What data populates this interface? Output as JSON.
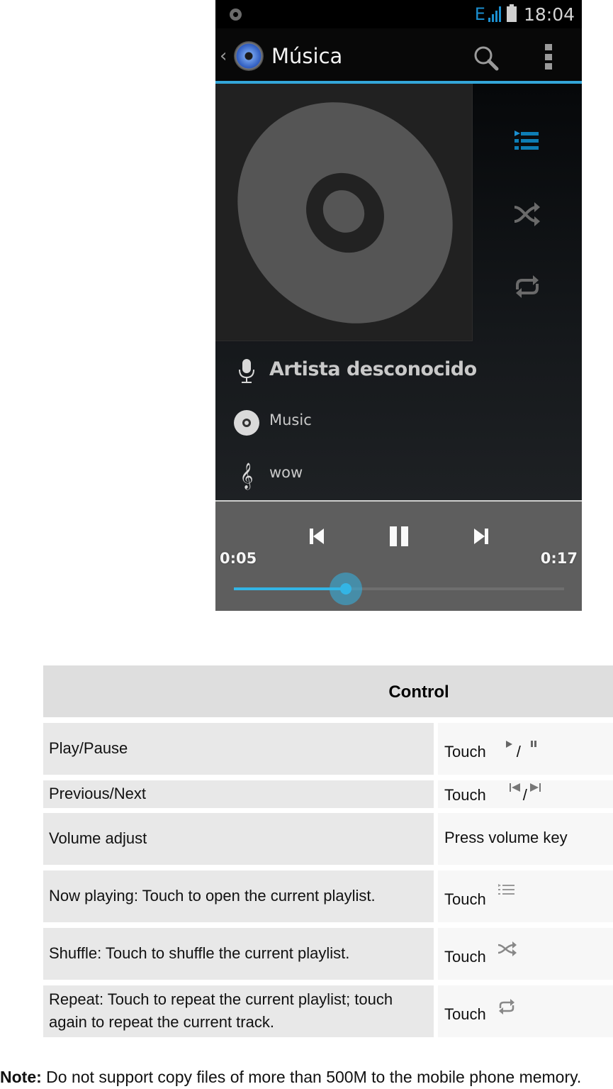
{
  "phone": {
    "status_bar": {
      "notification_icon": "circle-notification-icon",
      "network_type": "E",
      "signal_icon": "signal-bars-icon",
      "battery_icon": "battery-icon",
      "time": "18:04"
    },
    "action_bar": {
      "back_icon": "chevron-left-icon",
      "app_icon": "speaker-icon",
      "title": "Música",
      "search_icon": "search-icon",
      "overflow_icon": "overflow-menu-icon",
      "accent_color": "#33a6d9"
    },
    "artwork": {
      "icon": "album-disc-icon"
    },
    "side_controls": [
      {
        "name": "now-playing",
        "icon": "playlist-icon",
        "active": true,
        "color": "#1b8fd0"
      },
      {
        "name": "shuffle",
        "icon": "shuffle-icon",
        "active": false,
        "color": "#666666"
      },
      {
        "name": "repeat",
        "icon": "repeat-icon",
        "active": false,
        "color": "#666666"
      }
    ],
    "track_info": {
      "artist": "Artista desconocido",
      "album": "Music",
      "title": "wow"
    },
    "playback": {
      "elapsed": "0:05",
      "duration": "0:17",
      "progress_fraction": 0.34,
      "state": "playing",
      "accent_color": "#33b5e5",
      "buttons": [
        "previous",
        "pause",
        "next"
      ]
    }
  },
  "table": {
    "header": "Control",
    "rows": [
      {
        "action": "Play/Pause",
        "method": "Touch",
        "icons": [
          "play-icon",
          "pause-icon"
        ],
        "separator": "/"
      },
      {
        "action": "Previous/Next",
        "method": "Touch",
        "icons": [
          "previous-icon",
          "next-icon"
        ],
        "separator": "/"
      },
      {
        "action": "Volume adjust",
        "method": "Press volume key",
        "icons": []
      },
      {
        "action": "Now playing: Touch to open the current playlist.",
        "method": "Touch",
        "icons": [
          "playlist-icon"
        ]
      },
      {
        "action": "Shuffle: Touch to shuffle the current playlist.",
        "method": "Touch",
        "icons": [
          "shuffle-icon"
        ]
      },
      {
        "action": "Repeat: Touch to repeat the current playlist; touch again to repeat the current track.",
        "method": "Touch",
        "icons": [
          "repeat-icon"
        ]
      }
    ]
  },
  "note": {
    "label": "Note:",
    "text": " Do not support copy files of more than 500M to the mobile phone memory."
  }
}
